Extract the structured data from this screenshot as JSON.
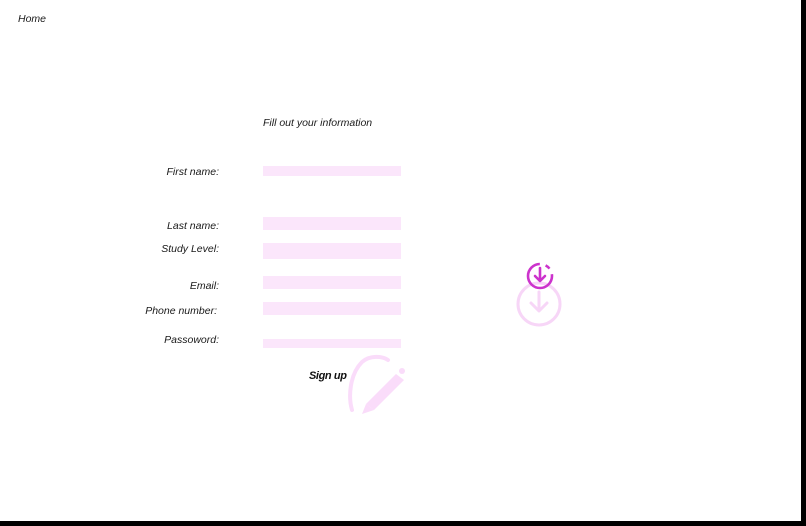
{
  "nav": {
    "home_label": "Home"
  },
  "form": {
    "title": "Fill out your information",
    "fields": [
      {
        "label": "First name:",
        "value": ""
      },
      {
        "label": "Last name:",
        "value": ""
      },
      {
        "label": "Study Level:",
        "value": ""
      },
      {
        "label": "Email:",
        "value": ""
      },
      {
        "label": "Phone number:",
        "value": ""
      },
      {
        "label": "Passoword:",
        "value": ""
      }
    ],
    "submit_label": "Sign up"
  },
  "icons": {
    "download": "download-circle-icon",
    "download_faded": "download-circle-icon",
    "signature": "signature-pen-icon"
  },
  "colors": {
    "field_bg": "#fbe6fb",
    "accent": "#cc33cc",
    "accent_faded": "#f6d2f6"
  }
}
